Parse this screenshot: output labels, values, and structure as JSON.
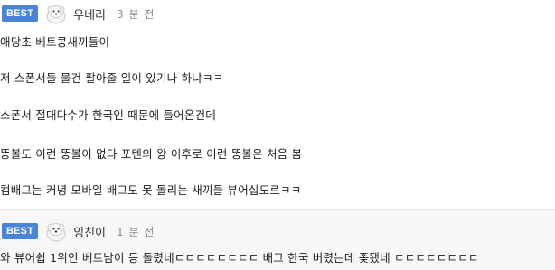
{
  "comments": [
    {
      "badge": "BEST",
      "author": "우네리",
      "time": "3 분 전",
      "lines": [
        "애당초 베트콩새끼들이",
        "저 스폰서들 물건 팔아줄 일이 있기나 하냐ㅋㅋ",
        "스폰서 절대다수가 한국인 때문에 들어온건데",
        "똥볼도 이런 똥볼이 없다 포텐의 왕 이후로 이런 똥볼은 처음 봄",
        "컴배그는 커녕 모바일 배그도 못 돌리는 새끼들 뷰어십도르ㅋㅋ"
      ]
    },
    {
      "badge": "BEST",
      "author": "잉친이",
      "time": "1 분 전",
      "lines": [
        "와 뷰어쉽 1위인 베트남이 등 돌렸네ㄷㄷㄷㄷㄷㄷㄷㄷ 배그 한국 버렸는데 좆됐네 ㄷㄷㄷㄷㄷㄷㄷㄷ"
      ]
    }
  ],
  "colors": {
    "badge_bg": "#4a84d9",
    "second_comment_bg": "#f7f7f7"
  },
  "icons": {
    "avatar": "white-dog-avatar-icon"
  }
}
